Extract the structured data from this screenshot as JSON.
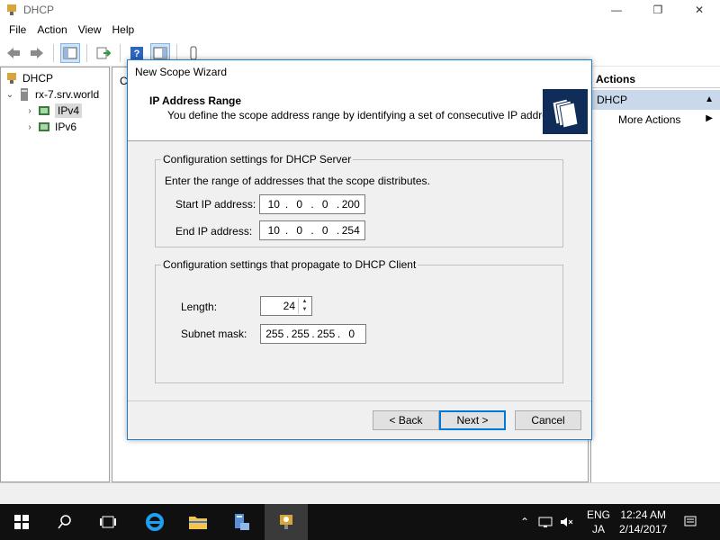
{
  "window": {
    "title": "DHCP"
  },
  "menu": [
    "File",
    "Action",
    "View",
    "Help"
  ],
  "tree": {
    "root": "DHCP",
    "server": "rx-7.srv.world",
    "ipv4": "IPv4",
    "ipv6": "IPv6"
  },
  "middle": {
    "column_header": "C"
  },
  "actions": {
    "header": "Actions",
    "section": "DHCP",
    "item": "More Actions"
  },
  "wizard": {
    "title": "New Scope Wizard",
    "heading": "IP Address Range",
    "subheading": "You define the scope address range by identifying a set of consecutive IP addresses.",
    "group1": {
      "legend": "Configuration settings for DHCP Server",
      "intro": "Enter the range of addresses that the scope distributes.",
      "start_label": "Start IP address:",
      "start_ip": [
        "10",
        "0",
        "0",
        "200"
      ],
      "end_label": "End IP address:",
      "end_ip": [
        "10",
        "0",
        "0",
        "254"
      ]
    },
    "group2": {
      "legend": "Configuration settings that propagate to DHCP Client",
      "length_label": "Length:",
      "length_value": "24",
      "mask_label": "Subnet mask:",
      "mask": [
        "255",
        "255",
        "255",
        "0"
      ]
    },
    "buttons": {
      "back": "< Back",
      "next": "Next >",
      "cancel": "Cancel"
    }
  },
  "taskbar": {
    "lang_top": "ENG",
    "lang_bottom": "JA",
    "time": "12:24 AM",
    "date": "2/14/2017"
  }
}
